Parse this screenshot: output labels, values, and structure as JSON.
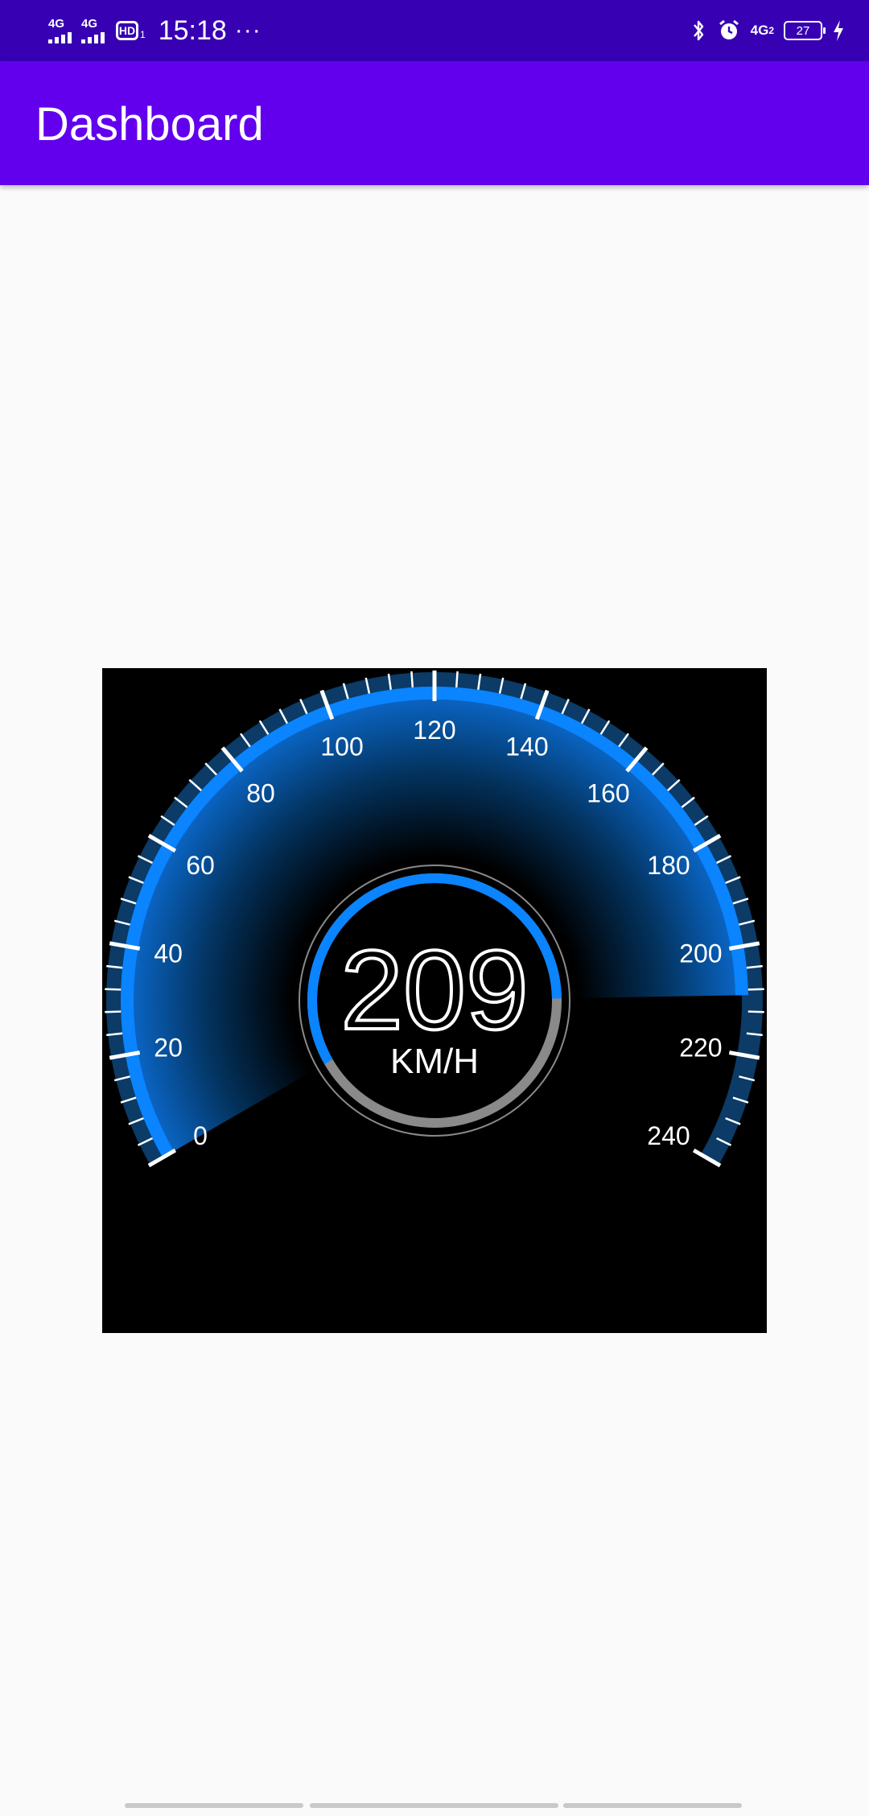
{
  "status_bar": {
    "sim1_label": "4G",
    "sim2_label": "4G",
    "hd_label": "HD",
    "hd_sub": "1",
    "time": "15:18",
    "more": "···",
    "net_label": "4G",
    "net_sub": "2",
    "battery_level": "27",
    "icons": [
      "signal-icon",
      "signal-icon",
      "hd-icon",
      "bluetooth-icon",
      "alarm-icon",
      "network-icon",
      "battery-icon",
      "charging-icon"
    ]
  },
  "app_bar": {
    "title": "Dashboard"
  },
  "speedometer": {
    "value": "209",
    "unit": "KM/H",
    "min": 0,
    "max": 240,
    "ticks": [
      "0",
      "20",
      "40",
      "60",
      "80",
      "100",
      "120",
      "140",
      "160",
      "180",
      "200",
      "220",
      "240"
    ],
    "colors": {
      "background": "#000000",
      "arc": "#0a84ff",
      "arc_dark": "#0b3b66",
      "glow": "#0a6fd8",
      "inner_ring_remaining": "#8a8a8a",
      "text": "#ffffff"
    }
  }
}
